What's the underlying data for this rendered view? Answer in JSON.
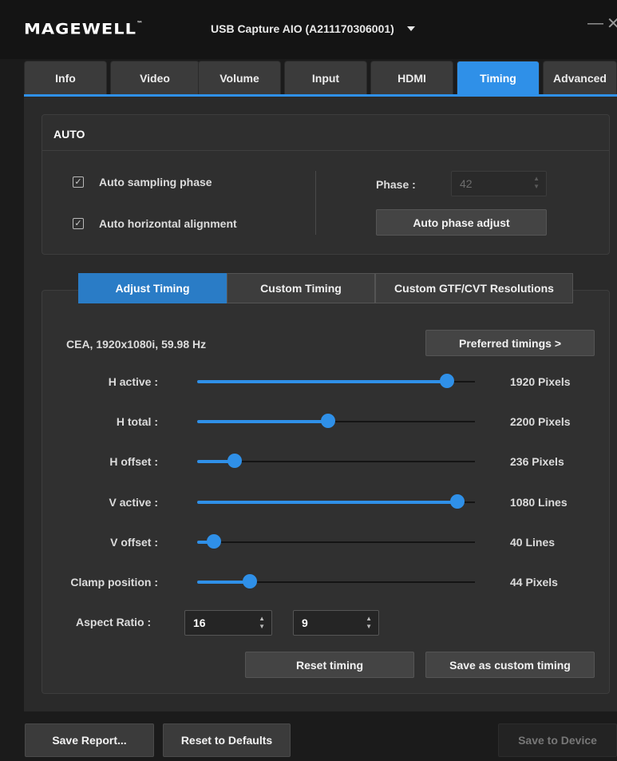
{
  "app": {
    "brand": "MAGEWELL",
    "brand_tm": "™",
    "device": "USB Capture AIO (A211170306001)",
    "minimize": "—",
    "close": "✕"
  },
  "tabs": [
    {
      "label": "Info"
    },
    {
      "label": "Video"
    },
    {
      "label": "Volume"
    },
    {
      "label": "Input"
    },
    {
      "label": "HDMI"
    },
    {
      "label": "Timing",
      "active": true
    },
    {
      "label": "Advanced"
    }
  ],
  "auto": {
    "title": "AUTO",
    "sampling_phase": {
      "label": "Auto sampling phase",
      "checked": true
    },
    "horizontal_alignment": {
      "label": "Auto horizontal alignment",
      "checked": true
    },
    "phase_label": "Phase :",
    "phase_value": "42",
    "phase_adjust_button": "Auto phase adjust"
  },
  "subtabs": [
    {
      "label": "Adjust Timing",
      "active": true
    },
    {
      "label": "Custom Timing"
    },
    {
      "label": "Custom GTF/CVT Resolutions"
    }
  ],
  "timing": {
    "resolution": "CEA, 1920x1080i, 59.98 Hz",
    "preferred_button": "Preferred timings >",
    "sliders": [
      {
        "label": "H active :",
        "value": "1920 Pixels",
        "fraction": 0.9
      },
      {
        "label": "H total :",
        "value": "2200 Pixels",
        "fraction": 0.47
      },
      {
        "label": "H offset :",
        "value": "236 Pixels",
        "fraction": 0.135
      },
      {
        "label": "V active :",
        "value": "1080 Lines",
        "fraction": 0.935
      },
      {
        "label": "V offset :",
        "value": "40 Lines",
        "fraction": 0.06
      },
      {
        "label": "Clamp position :",
        "value": "44 Pixels",
        "fraction": 0.19
      }
    ],
    "aspect_label": "Aspect Ratio :",
    "aspect_w": "16",
    "aspect_h": "9",
    "reset_button": "Reset timing",
    "save_custom_button": "Save as custom timing"
  },
  "footer": {
    "save_report": "Save Report...",
    "reset_defaults": "Reset to Defaults",
    "save_device": "Save to Device"
  },
  "colors": {
    "accent": "#2f90e8",
    "background": "#1b1b1b",
    "panel": "#2a2a2a"
  }
}
